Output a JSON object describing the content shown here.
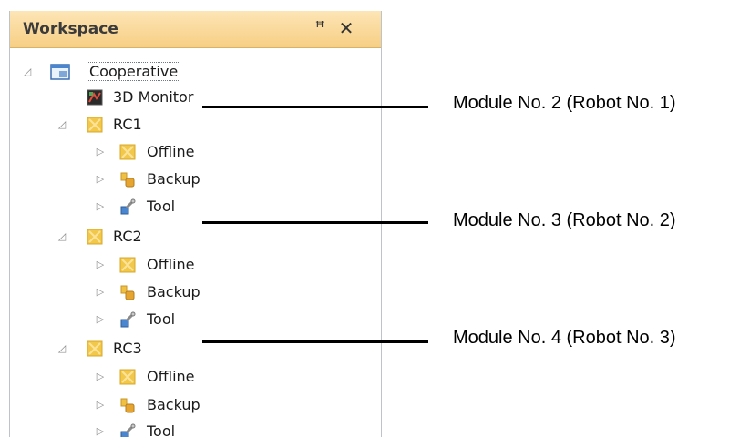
{
  "workspace": {
    "title": "Workspace",
    "pin_icon": "pin-icon",
    "close_icon": "close-icon",
    "pin_glyph": "ꟸ",
    "close_glyph": "✕"
  },
  "tree": {
    "root": {
      "label": "Cooperative",
      "icon": "project-icon",
      "expanded": true
    },
    "monitor": {
      "label": "3D Monitor",
      "icon": "3d-monitor-icon"
    },
    "controllers": [
      {
        "label": "RC1",
        "icon": "controller-icon",
        "expanded": true,
        "children": [
          {
            "label": "Offline",
            "icon": "offline-icon"
          },
          {
            "label": "Backup",
            "icon": "backup-icon"
          },
          {
            "label": "Tool",
            "icon": "tool-icon"
          }
        ]
      },
      {
        "label": "RC2",
        "icon": "controller-icon",
        "expanded": true,
        "children": [
          {
            "label": "Offline",
            "icon": "offline-icon"
          },
          {
            "label": "Backup",
            "icon": "backup-icon"
          },
          {
            "label": "Tool",
            "icon": "tool-icon"
          }
        ]
      },
      {
        "label": "RC3",
        "icon": "controller-icon",
        "expanded": true,
        "children": [
          {
            "label": "Offline",
            "icon": "offline-icon"
          },
          {
            "label": "Backup",
            "icon": "backup-icon"
          },
          {
            "label": "Tool",
            "icon": "tool-icon"
          }
        ]
      }
    ]
  },
  "callouts": [
    "Module No. 2 (Robot No. 1)",
    "Module No. 3 (Robot No. 2)",
    "Module No. 4 (Robot No. 3)"
  ],
  "colors": {
    "title_bar": "#f7cf84",
    "controller_icon": "#f2c84b",
    "expander": "#8d8d8d"
  }
}
